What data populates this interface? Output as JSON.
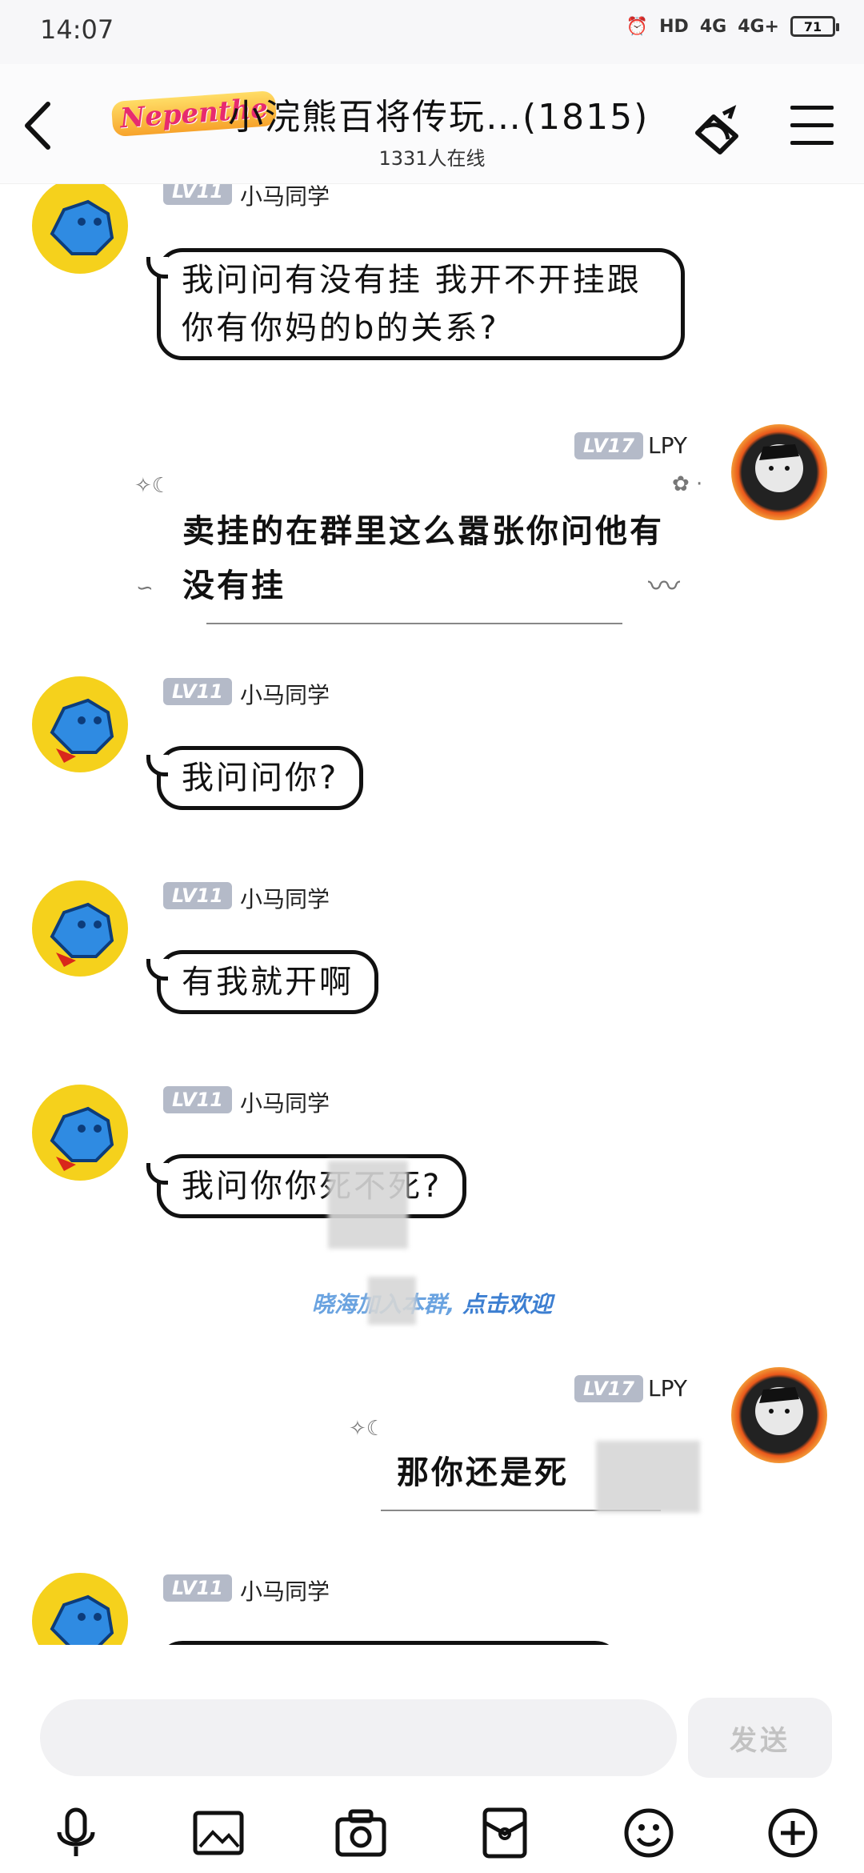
{
  "status_bar": {
    "time": "14:07",
    "hd": "HD",
    "net1": "4G",
    "net2": "4G+",
    "battery": "71"
  },
  "header": {
    "group_logo": "Nepenthe",
    "title": "小浣熊百将传玩…(1815)",
    "online": "1331人在线"
  },
  "messages": [
    {
      "side": "left",
      "level": "LV11",
      "name": "小马同学",
      "text": "我问问有没有挂 我开不开挂跟你有你妈的b的关系?"
    },
    {
      "side": "right",
      "level": "LV17",
      "name": "LPY",
      "text": "卖挂的在群里这么嚣张你问他有没有挂"
    },
    {
      "side": "left",
      "level": "LV11",
      "name": "小马同学",
      "text": "我问问你?"
    },
    {
      "side": "left",
      "level": "LV11",
      "name": "小马同学",
      "text": "有我就开啊"
    },
    {
      "side": "left",
      "level": "LV11",
      "name": "小马同学",
      "text": "我问你你死不死?"
    },
    {
      "side": "right",
      "level": "LV17",
      "name": "LPY",
      "text": "那你还是死"
    },
    {
      "side": "left",
      "level": "LV11",
      "name": "小马同学",
      "text": ""
    }
  ],
  "system": {
    "text": "晓海加入本群,",
    "link": "点击欢迎"
  },
  "input": {
    "placeholder": "",
    "send_label": "发送"
  }
}
